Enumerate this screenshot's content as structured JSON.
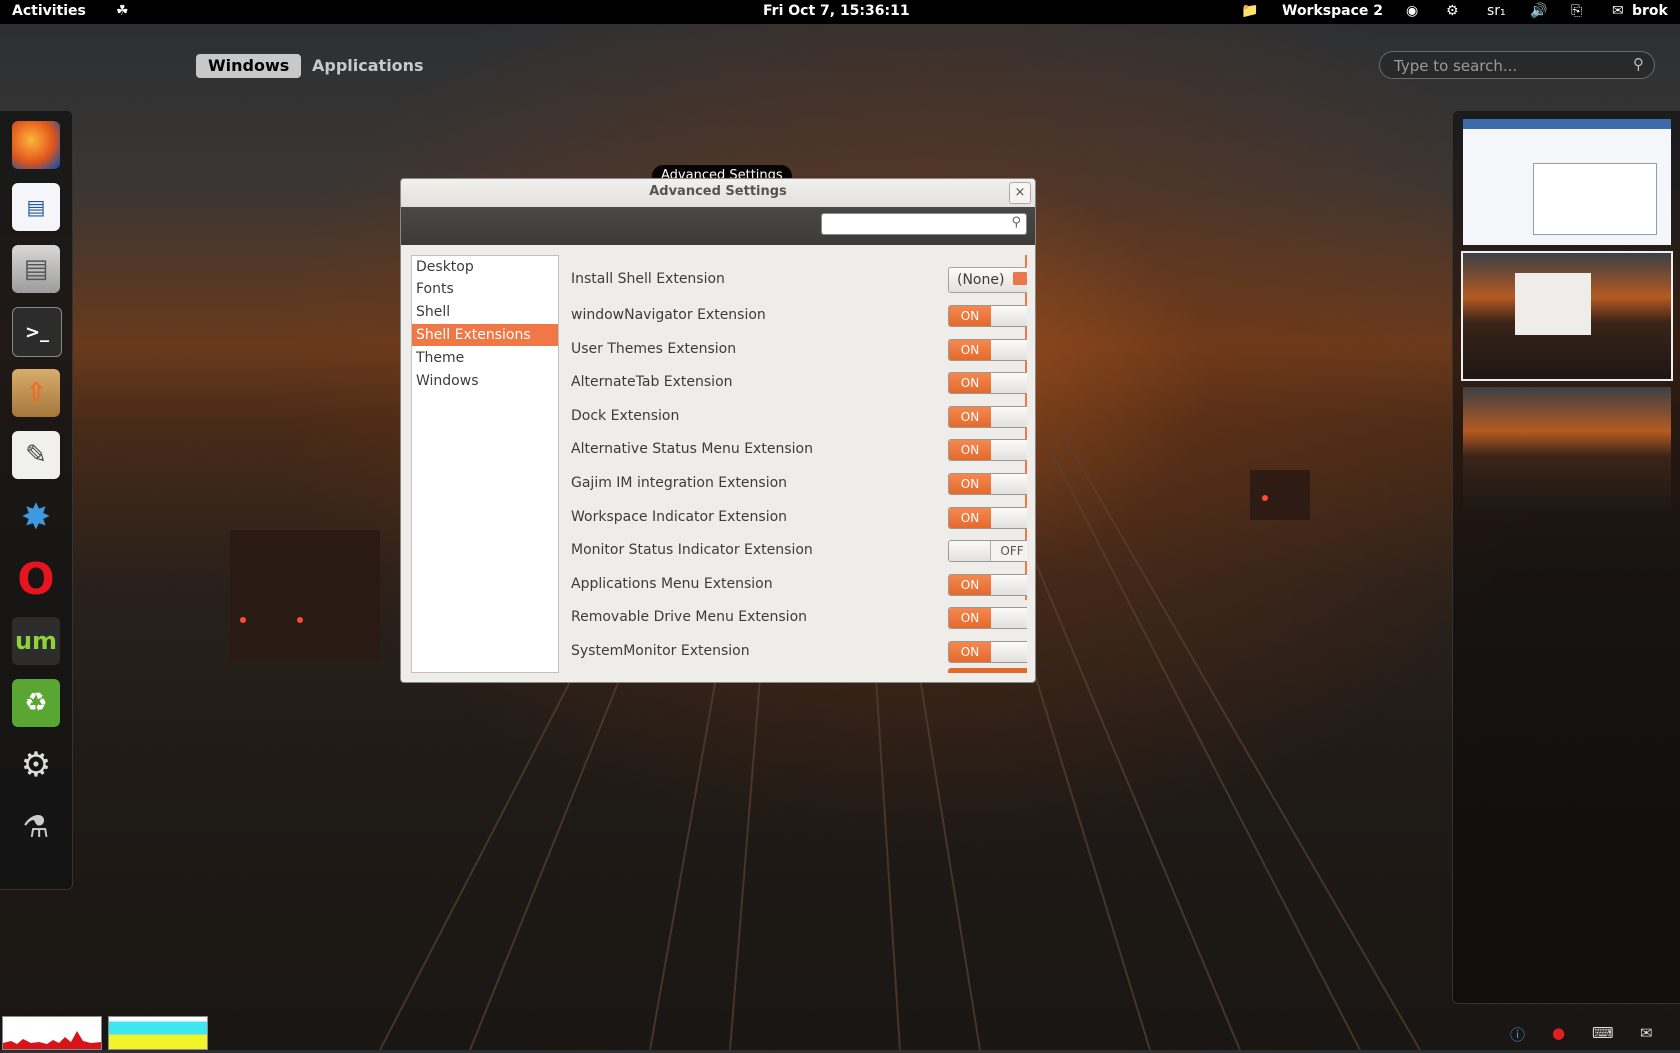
{
  "topbar": {
    "activities": "Activities",
    "clock": "Fri Oct  7, 15:36:11",
    "workspace": "Workspace 2",
    "keyboard_layout": "sr₁",
    "user": "brok"
  },
  "overview": {
    "tab_windows": "Windows",
    "tab_applications": "Applications",
    "search_placeholder": "Type to search..."
  },
  "dock": {
    "items": [
      "firefox-icon",
      "writer-icon",
      "file-cabinet-icon",
      "terminal-icon",
      "package-installer-icon",
      "text-editor-icon",
      "shotwell-icon",
      "opera-icon",
      "universal-media-server-icon",
      "recycle-icon",
      "system-settings-icon",
      "media-tools-icon"
    ]
  },
  "dialog": {
    "tooltip": "Advanced Settings",
    "title": "Advanced Settings",
    "close": "×",
    "sidebar": [
      "Desktop",
      "Fonts",
      "Shell",
      "Shell Extensions",
      "Theme",
      "Windows"
    ],
    "selected_section": "Shell Extensions",
    "install_label": "Install Shell Extension",
    "install_button": "(None)",
    "extensions": [
      {
        "name": "windowNavigator Extension",
        "state": "ON"
      },
      {
        "name": "User Themes Extension",
        "state": "ON"
      },
      {
        "name": "AlternateTab Extension",
        "state": "ON"
      },
      {
        "name": "Dock Extension",
        "state": "ON"
      },
      {
        "name": "Alternative Status Menu Extension",
        "state": "ON"
      },
      {
        "name": "Gajim IM integration Extension",
        "state": "ON"
      },
      {
        "name": "Workspace Indicator Extension",
        "state": "ON"
      },
      {
        "name": "Monitor Status Indicator Extension",
        "state": "OFF"
      },
      {
        "name": "Applications Menu Extension",
        "state": "ON"
      },
      {
        "name": "Removable Drive Menu Extension",
        "state": "ON"
      },
      {
        "name": "SystemMonitor Extension",
        "state": "ON"
      }
    ]
  },
  "colors": {
    "accent": "#f07746",
    "panel": "#000000"
  }
}
